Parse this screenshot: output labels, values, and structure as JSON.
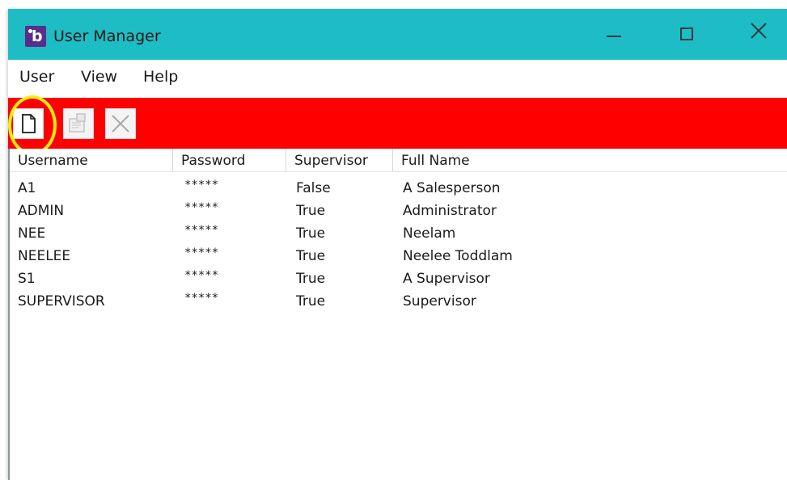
{
  "window": {
    "title": "User Manager",
    "app_icon_glyph": "b",
    "controls": {
      "minimize_icon": "minimize-icon",
      "maximize_icon": "maximize-icon",
      "close_icon": "close-icon"
    }
  },
  "colors": {
    "titlebar": "#1ebcc4",
    "toolbar": "#ff0000",
    "app_icon": "#5a2d8c",
    "highlight": "#f3ee0f"
  },
  "menu": {
    "user": "User",
    "view": "View",
    "help": "Help"
  },
  "toolbar": {
    "buttons": [
      {
        "icon": "new-document-icon",
        "enabled": true
      },
      {
        "icon": "properties-icon",
        "enabled": false
      },
      {
        "icon": "delete-icon",
        "enabled": false
      }
    ]
  },
  "table": {
    "columns": [
      "Username",
      "Password",
      "Supervisor",
      "Full Name"
    ],
    "rows": [
      {
        "username": "A1",
        "password": "*****",
        "supervisor": "False",
        "full_name": "A Salesperson"
      },
      {
        "username": "ADMIN",
        "password": "*****",
        "supervisor": "True",
        "full_name": "Administrator"
      },
      {
        "username": "NEE",
        "password": "*****",
        "supervisor": "True",
        "full_name": "Neelam"
      },
      {
        "username": "NEELEE",
        "password": "*****",
        "supervisor": "True",
        "full_name": "Neelee Toddlam"
      },
      {
        "username": "S1",
        "password": "*****",
        "supervisor": "True",
        "full_name": "A Supervisor"
      },
      {
        "username": "SUPERVISOR",
        "password": "*****",
        "supervisor": "True",
        "full_name": "Supervisor"
      }
    ]
  }
}
